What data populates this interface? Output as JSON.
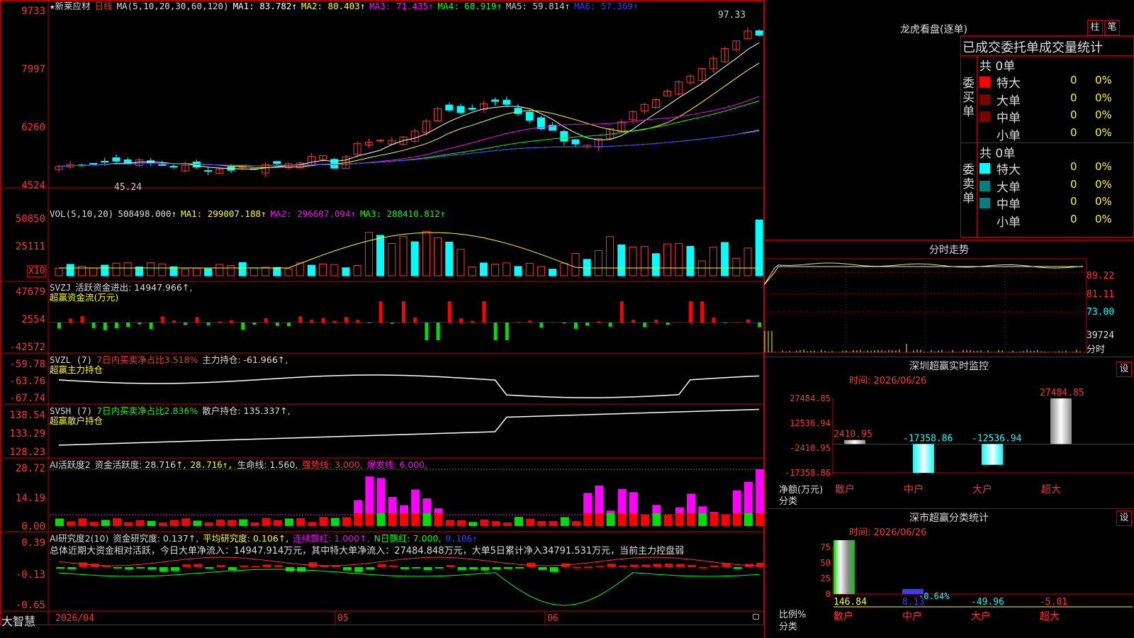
{
  "stock": {
    "star": "★",
    "name": "新莱应材",
    "period": "日线",
    "ma_param": "MA(5,10,20,30,60,120)",
    "ma": [
      {
        "label": "MA1: 83.782↑",
        "color": "#ffffff"
      },
      {
        "label": "MA2: 80.403↑",
        "color": "#ffff00"
      },
      {
        "label": "MA3: 71.435↑",
        "color": "#ff00ff"
      },
      {
        "label": "MA4: 68.919↑",
        "color": "#00ff00"
      },
      {
        "label": "MA5: 59.814↑",
        "color": "#c0c0c0"
      },
      {
        "label": "MA6: 57.369↑",
        "color": "#3a3aff"
      }
    ]
  },
  "price_axis": [
    "9733",
    "7997",
    "6260",
    "4524"
  ],
  "price_marks": {
    "high": "97.33",
    "low": "45.24"
  },
  "vol": {
    "param": "VOL(5,10,20)",
    "value": "508498.000↑",
    "ma1": "MA1: 299007.188↑",
    "ma2": "MA2: 296607.094↑",
    "ma3": "MA3: 288410.812↑",
    "axis": [
      "50850",
      "25111"
    ],
    "unit": "X10"
  },
  "svzj": {
    "name": "SVZJ",
    "label": "活跃资金进出: 14947.966↑,",
    "sub": "超赢资金流(万元)",
    "axis": [
      "47679",
      "2554",
      "-42572"
    ]
  },
  "svzl": {
    "name": "SVZL (7)",
    "ratio": "7日内买卖净占比3.518%",
    "hold": "主力持仓: -61.966↑,",
    "sub": "超赢主力持仓",
    "axis": [
      "-59.78",
      "-63.76",
      "-67.74"
    ]
  },
  "svsh": {
    "name": "SVSH (7)",
    "ratio": "7日内买卖净占比2.836%",
    "hold": "散户持仓: 135.337↑,",
    "sub": "超赢散户持仓",
    "axis": [
      "138.54",
      "133.29",
      "128.23"
    ]
  },
  "ai1": {
    "name": "AI活跃度2",
    "active": "资金活跃度: 28.716↑,",
    "v2": "28.716↑,",
    "life": "生命线: 1.560,",
    "strong": "强势线: 3.000,",
    "burst": "爆发线: 6.000,",
    "axis": [
      "28.72",
      "14.19",
      "0.00"
    ]
  },
  "ai2": {
    "name": "AI研究度2(10)",
    "research": "资金研究度: 0.137↑,",
    "avg": "平均研究度: 0.106↑,",
    "cont": "连续飘红: 1.000↑,",
    "nday": "N日飘红: 7.000,",
    "val": "0.106↑",
    "summary": "总体近期大资金相对活跃，今日大单净流入：14947.914万元，其中特大单净流入：27484.848万元，大单5日累计净入34791.531万元，当前主力控盘弱",
    "axis": [
      "0.39",
      "-0.13",
      "-0.65"
    ]
  },
  "dates": [
    "2026/04",
    "05",
    "06"
  ],
  "brand": "大智慧",
  "right": {
    "lhb_title": "龙虎看盘(逐单)",
    "btn_zhu": "柱",
    "btn_bi": "笔",
    "tabs": "已成交委托单成交量统计",
    "buy_label": "委买单",
    "sell_label": "委卖单",
    "buy_total": "共 0单",
    "sell_total": "共 0单",
    "buy_rows": [
      {
        "label": "特大",
        "count": "0",
        "pct": "0%",
        "color": "#ff0000"
      },
      {
        "label": "大单",
        "count": "0",
        "pct": "0%",
        "color": "#800000"
      },
      {
        "label": "中单",
        "count": "0",
        "pct": "0%",
        "color": "#800000"
      },
      {
        "label": "小单",
        "count": "0",
        "pct": "0%",
        "color": "#000000"
      }
    ],
    "sell_rows": [
      {
        "label": "特大",
        "count": "0",
        "pct": "0%",
        "color": "#00ffff"
      },
      {
        "label": "大单",
        "count": "0",
        "pct": "0%",
        "color": "#008080"
      },
      {
        "label": "中单",
        "count": "0",
        "pct": "0%",
        "color": "#008080"
      },
      {
        "label": "小单",
        "count": "0",
        "pct": "0%",
        "color": "#000000"
      }
    ],
    "fs_title": "分时走势",
    "fs_axis": [
      "89.22",
      "81.11",
      "73.00",
      "39724"
    ],
    "fs_unit": "分时",
    "mon_title": "深圳超赢实时监控",
    "set_label": "设",
    "mon_time": "时间: 2026/06/26",
    "mon_axis": [
      "27484.85",
      "12536.94",
      "-2410.95",
      "-17358.86"
    ],
    "mon_bars": [
      {
        "cat": "散户",
        "label": "2410.95",
        "value": 2410.95
      },
      {
        "cat": "中户",
        "label": "-17358.86",
        "value": -17358.86
      },
      {
        "cat": "大户",
        "label": "-12536.94",
        "value": -12536.94
      },
      {
        "cat": "超大",
        "label": "27484.85",
        "value": 27484.85
      }
    ],
    "mon_ylabel": "净额(万元)",
    "mon_xlabel": "分类",
    "cls_title": "深市超赢分类统计",
    "cls_time": "时间: 2026/06/26",
    "cls_axis": [
      "75",
      "50",
      "25",
      "0"
    ],
    "cls_bars": [
      {
        "cat": "散户",
        "label": "146.84",
        "value": 146.84
      },
      {
        "cat": "中户",
        "label": "8.13",
        "value": 8.13
      },
      {
        "cat": "大户",
        "label": "-49.96",
        "value": -49.96
      },
      {
        "cat": "超大",
        "label": "-5.01",
        "value": -5.01
      }
    ],
    "cls_mid_label": "-0.64%",
    "cls_ylabel": "比例%",
    "cls_xlabel": "分类"
  },
  "colors": {
    "up": "#ff3232",
    "down": "#00ffff",
    "border": "#c00000",
    "axis_text": "#ff3232"
  }
}
